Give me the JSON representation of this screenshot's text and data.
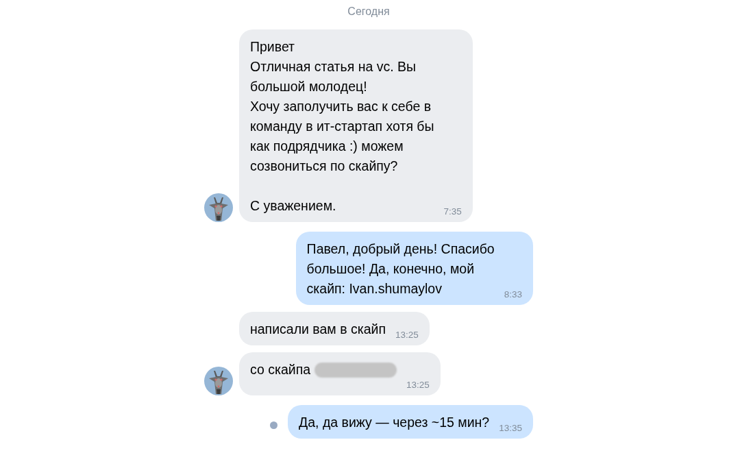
{
  "date_divider": "Сегодня",
  "messages": [
    {
      "kind": "in",
      "text": "Привет\nОтличная статья на vc. Вы\nбольшой молодец!\nХочу заполучить вас к себе в\nкоманду в ит-стартап хотя бы\nкак подрядчика :) можем\nсозвониться по скайпу?\n\nС уважением.",
      "time": "7:35",
      "avatar": true
    },
    {
      "kind": "out",
      "text": "Павел, добрый день! Спасибо\nбольшое! Да, конечно, мой\nскайп: Ivan.shumaylov",
      "time": "8:33"
    },
    {
      "kind": "in",
      "text": "написали вам в скайп",
      "time": "13:25"
    },
    {
      "kind": "in",
      "text": "со скайпа",
      "time": "13:25",
      "avatar": true,
      "redacted": true
    },
    {
      "kind": "out",
      "text": "Да, да вижу — через ~15 мин?",
      "time": "13:35",
      "unread": true
    }
  ]
}
